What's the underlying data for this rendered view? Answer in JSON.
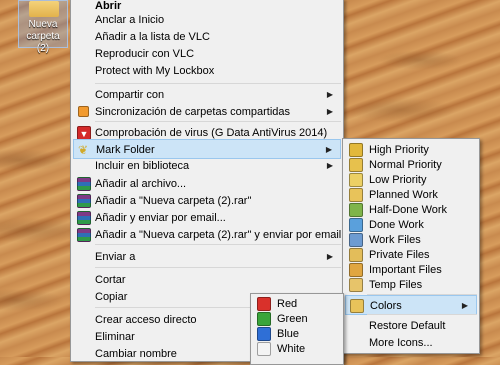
{
  "desktop": {
    "icon_label": "Nueva carpeta (2)"
  },
  "main_menu": {
    "open": "Abrir",
    "pin_start": "Anclar a Inicio",
    "vlc_add": "Añadir a la lista de VLC",
    "vlc_play": "Reproducir con VLC",
    "lockbox": "Protect with My Lockbox",
    "share": "Compartir con",
    "sync": "Sincronización de carpetas compartidas",
    "virus": "Comprobación de virus (G Data AntiVirus 2014)",
    "mark_folder": "Mark Folder",
    "library": "Incluir en biblioteca",
    "add_archive": "Añadir al archivo...",
    "add_rar": "Añadir a \"Nueva carpeta (2).rar\"",
    "add_email": "Añadir y enviar por email...",
    "add_rar_email": "Añadir a \"Nueva carpeta (2).rar\" y enviar por email",
    "send_to": "Enviar a",
    "cut": "Cortar",
    "copy": "Copiar",
    "shortcut": "Crear acceso directo",
    "delete": "Eliminar",
    "rename": "Cambiar nombre"
  },
  "submenu": {
    "items": [
      "High Priority",
      "Normal Priority",
      "Low Priority",
      "Planned Work",
      "Half-Done Work",
      "Done Work",
      "Work Files",
      "Private Files",
      "Important Files",
      "Temp Files"
    ],
    "colors": "Colors",
    "restore": "Restore Default",
    "more": "More Icons..."
  },
  "colors_menu": {
    "items": [
      {
        "label": "Red",
        "color": "#d9312b"
      },
      {
        "label": "Green",
        "color": "#3aa53a"
      },
      {
        "label": "Blue",
        "color": "#2f6fd6"
      },
      {
        "label": "White",
        "color": "#f4f4f4"
      }
    ]
  },
  "accent": {
    "highlight": "#cce4f7",
    "menu_bg": "#f0f0f0"
  }
}
